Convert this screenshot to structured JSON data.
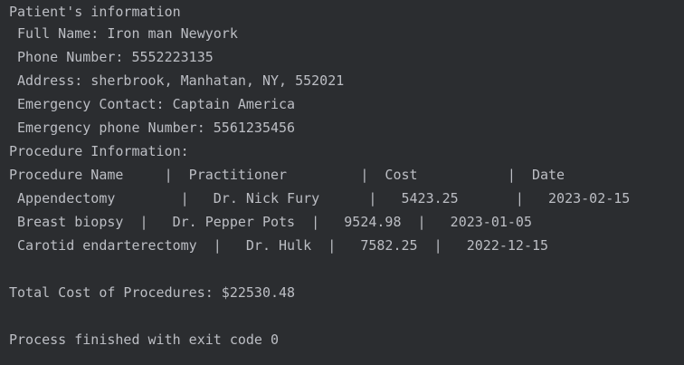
{
  "console": {
    "lines": [
      "Patient's information",
      " Full Name: Iron man Newyork",
      " Phone Number: 5552223135",
      " Address: sherbrook, Manhatan, NY, 552021",
      " Emergency Contact: Captain America",
      " Emergency phone Number: 5561235456",
      "Procedure Information:",
      "Procedure Name     |  Practitioner         |  Cost           |  Date",
      " Appendectomy        |   Dr. Nick Fury      |   5423.25       |   2023-02-15",
      " Breast biopsy  |   Dr. Pepper Pots  |   9524.98  |   2023-01-05",
      " Carotid endarterectomy  |   Dr. Hulk  |   7582.25  |   2022-12-15",
      "",
      "Total Cost of Procedures: $22530.48",
      "",
      "Process finished with exit code 0"
    ]
  },
  "colors": {
    "background": "#2b2d30",
    "text": "#bcbec4"
  }
}
